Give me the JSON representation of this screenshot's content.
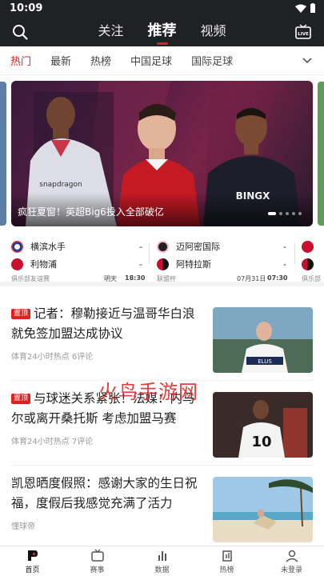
{
  "status": {
    "time": "10:09"
  },
  "header": {
    "tabs": [
      {
        "label": "关注"
      },
      {
        "label": "推荐"
      },
      {
        "label": "视频"
      }
    ],
    "live_label": "LIVE"
  },
  "subnav": {
    "items": [
      {
        "label": "热门"
      },
      {
        "label": "最新"
      },
      {
        "label": "热榜"
      },
      {
        "label": "中国足球"
      },
      {
        "label": "国际足球"
      }
    ]
  },
  "banner": {
    "caption": "疯狂夏窗！英超Big6投入全部破亿",
    "players": [
      {
        "number": "",
        "sponsor": "snapdragon"
      },
      {
        "number": "",
        "sponsor": ""
      },
      {
        "number": "",
        "sponsor": "BINGX"
      }
    ],
    "slide_count": 5,
    "active_slide": 1
  },
  "matches": [
    {
      "home": "横滨水手",
      "away": "利物浦",
      "home_score": "-",
      "away_score": "-",
      "competition": "俱乐部友谊赛",
      "date": "明天",
      "time": "18:30"
    },
    {
      "home": "迈阿密国际",
      "away": "阿特拉斯",
      "home_score": "-",
      "away_score": "-",
      "competition": "联盟杯",
      "date": "07月31日",
      "time": "07:30"
    },
    {
      "competition": "俱乐部"
    }
  ],
  "news": [
    {
      "badge": "置顶",
      "title": "记者：穆勒接近与温哥华白浪就免签加盟达成协议",
      "source": "体育24小时热点",
      "comments": "6评论",
      "thumb_text": "ELUS"
    },
    {
      "badge": "置顶",
      "title": "与球迷关系紧张！法媒：内马尔或离开桑托斯 考虑加盟马赛",
      "source": "体育24小时热点",
      "comments": "7评论",
      "thumb_text": "10"
    },
    {
      "badge": "",
      "title": "凯恩晒度假照：感谢大家的生日祝福，度假后我感觉充满了活力",
      "source": "懂球帝",
      "comments": ""
    }
  ],
  "watermark": "火鸟手游网",
  "tabbar": [
    {
      "label": "首页"
    },
    {
      "label": "赛事"
    },
    {
      "label": "数据"
    },
    {
      "label": "热榜"
    },
    {
      "label": "未登录"
    }
  ],
  "colors": {
    "accent": "#e02020",
    "header_bg": "#202124"
  }
}
